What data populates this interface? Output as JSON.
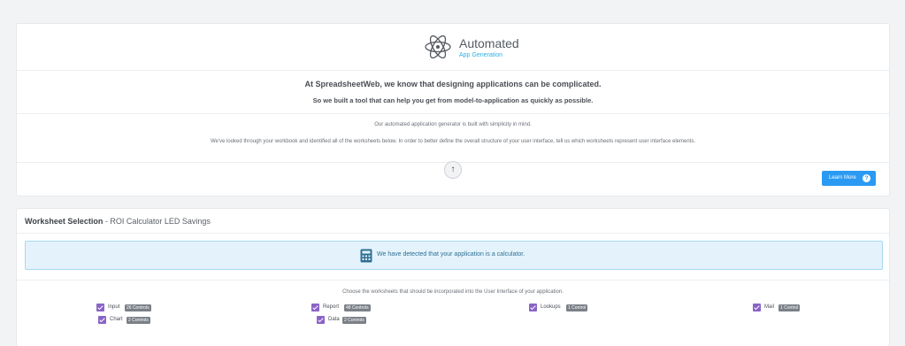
{
  "header": {
    "brand_title": "Automated",
    "brand_subtitle": "App Generation",
    "lead_line_1": "At SpreadsheetWeb, we know that designing applications can be complicated.",
    "lead_line_2": "So we built a tool that can help you get from model-to-application as quickly as possible.",
    "info_line_1": "Our automated application generator is built with simplicity in mind.",
    "info_line_2": "We've looked through your workbook and identified all of the worksheets below. In order to better define the overall structure of your user interface, tell us which worksheets represent user interface elements.",
    "collapse_glyph": "↑",
    "learn_more_label": "Learn More",
    "learn_more_icon": "?"
  },
  "worksheet_selection": {
    "title_bold": "Worksheet Selection",
    "title_rest": " - ROI Calculator LED Savings",
    "alert_text": "We have detected that your application is a calculator.",
    "instruction": "Choose the worksheets that should be incorporated into the User Interface of your application.",
    "worksheets": [
      {
        "name": "Input",
        "badge": "26 Controls",
        "checked": true
      },
      {
        "name": "Report",
        "badge": "48 Controls",
        "checked": true
      },
      {
        "name": "Lookups",
        "badge": "1 Control",
        "checked": true
      },
      {
        "name": "Mail",
        "badge": "1 Control",
        "checked": true
      },
      {
        "name": "Chart",
        "badge": "2 Controls",
        "checked": true
      },
      {
        "name": "Data",
        "badge": "2 Controls",
        "checked": true
      }
    ]
  },
  "colors": {
    "accent_blue": "#2b9af3",
    "subtitle_cyan": "#2ab0e4",
    "checkbox_purple": "#8a63c9",
    "badge_gray": "#7b8088",
    "alert_bg": "#e4f3fb"
  }
}
